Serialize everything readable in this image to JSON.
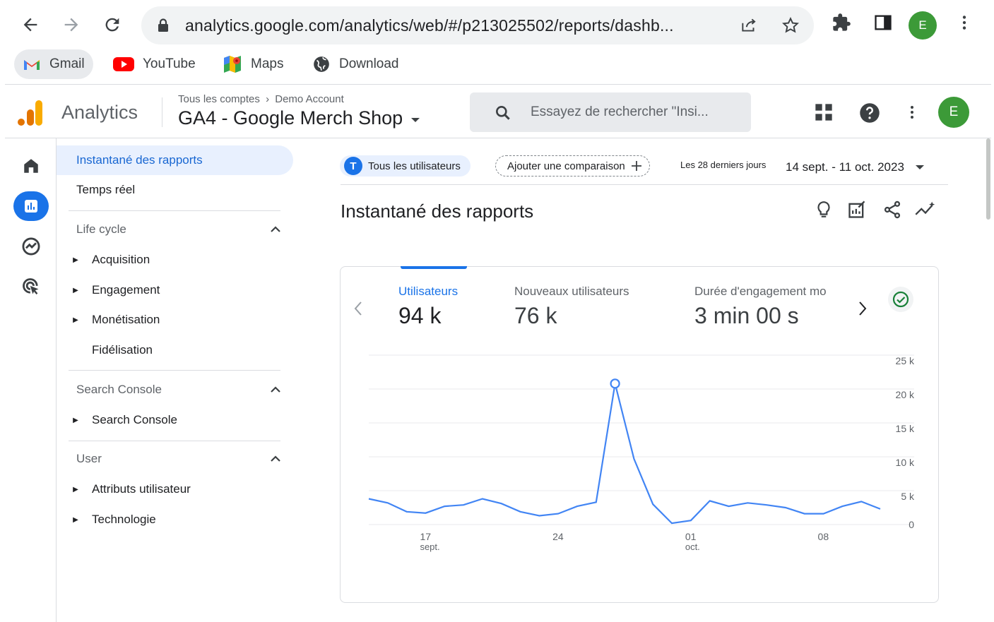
{
  "browser": {
    "url": "analytics.google.com/analytics/web/#/p213025502/reports/dashb...",
    "profile_initial": "E",
    "bookmarks": [
      {
        "label": "Gmail"
      },
      {
        "label": "YouTube"
      },
      {
        "label": "Maps"
      },
      {
        "label": "Download"
      }
    ]
  },
  "header": {
    "brand": "Analytics",
    "breadcrumb_root": "Tous les comptes",
    "breadcrumb_account": "Demo Account",
    "property": "GA4 - Google Merch Shop",
    "search_placeholder": "Essayez de rechercher \"Insi...",
    "avatar_initial": "E"
  },
  "nav": {
    "selected": "Instantané des rapports",
    "realtime": "Temps réel",
    "sections": [
      {
        "title": "Life cycle",
        "items": [
          "Acquisition",
          "Engagement",
          "Monétisation",
          "Fidélisation"
        ]
      },
      {
        "title": "Search Console",
        "items": [
          "Search Console"
        ]
      },
      {
        "title": "User",
        "items": [
          "Attributs utilisateur",
          "Technologie"
        ]
      }
    ]
  },
  "filters": {
    "segment_initial": "T",
    "segment": "Tous les utilisateurs",
    "compare": "Ajouter une comparaison",
    "range_label": "Les 28 derniers jours",
    "range_value": "14 sept. - 11 oct. 2023"
  },
  "main": {
    "title": "Instantané des rapports"
  },
  "metrics": [
    {
      "label": "Utilisateurs",
      "value": "94 k"
    },
    {
      "label": "Nouveaux utilisateurs",
      "value": "76 k"
    },
    {
      "label": "Durée d'engagement mo",
      "value": "3 min 00 s"
    }
  ],
  "colors": {
    "accent": "#1a73e8",
    "line": "#4285f4",
    "ga_orange": "#f9ab00",
    "ga_dark": "#e37400",
    "profile_green": "#3c9a38"
  },
  "chart_data": {
    "type": "line",
    "series": [
      {
        "values": [
          3800,
          3200,
          1900,
          1700,
          2700,
          2900,
          3800,
          3100,
          1900,
          1300,
          1600,
          2700,
          3300,
          20800,
          9700,
          3000,
          200,
          600,
          3500,
          2700,
          3200,
          2900,
          2500,
          1600,
          1600,
          2700,
          3400,
          2300
        ]
      }
    ],
    "x": [
      "14 sept.",
      "15",
      "16",
      "17",
      "18",
      "19",
      "20",
      "21",
      "22",
      "23",
      "24",
      "25",
      "26",
      "27",
      "28",
      "29",
      "30",
      "01 oct.",
      "02",
      "03",
      "04",
      "05",
      "06",
      "07",
      "08",
      "09",
      "10",
      "11"
    ],
    "x_ticks": [
      {
        "label": "17",
        "sub": "sept.",
        "index": 3
      },
      {
        "label": "24",
        "sub": "",
        "index": 10
      },
      {
        "label": "01",
        "sub": "oct.",
        "index": 17
      },
      {
        "label": "08",
        "sub": "",
        "index": 24
      }
    ],
    "y_ticks": [
      "0",
      "5 k",
      "10 k",
      "15 k",
      "20 k",
      "25 k"
    ],
    "ylim": [
      0,
      25000
    ],
    "highlight_index": 13,
    "grid": true
  }
}
